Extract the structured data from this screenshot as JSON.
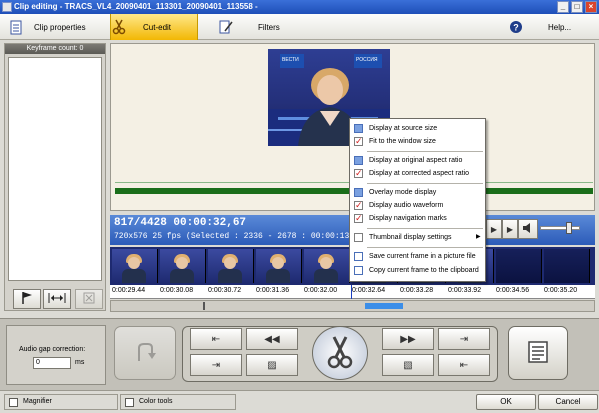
{
  "window": {
    "title": "Clip editing - TRACS_VL4_20090401_113301_20090401_113558 -",
    "controls": [
      "_",
      "□",
      "×"
    ]
  },
  "toolbar": {
    "clip_properties": "Clip properties",
    "cut_edit": "Cut-edit",
    "filters": "Filters",
    "help": "Help..."
  },
  "keyframes": {
    "header": "Keyframe count: 0"
  },
  "video": {
    "logo": "ВЕСТИ",
    "banner": "РОССИЯ"
  },
  "info": {
    "position": "817/4428   00:00:32,67",
    "details": "720x576 25 fps  (Selected : 2336 - 2678 : 00:00:13,71)"
  },
  "timeline": {
    "times": [
      "0:00:29.44",
      "0:00:30.08",
      "0:00:30.72",
      "0:00:31.36",
      "0:00:32.00",
      "0:00:32.64",
      "0:00:33.28",
      "0:00:33.92",
      "0:00:34.56",
      "0:00:35.20"
    ]
  },
  "context_menu": {
    "items": [
      "Display at source size",
      "Fit to the window size",
      "Display at original aspect ratio",
      "Display at corrected aspect ratio",
      "Overlay mode display",
      "Display audio waveform",
      "Display navigation marks",
      "Thumbnail display settings",
      "Save current frame in a picture file",
      "Copy current frame to the clipboard"
    ]
  },
  "audio_gap": {
    "label": "Audio gap correction:",
    "value": "0",
    "unit": "ms"
  },
  "status": {
    "magnifier": "Magnifier",
    "color_tools": "Color tools",
    "ok": "OK",
    "cancel": "Cancel"
  }
}
